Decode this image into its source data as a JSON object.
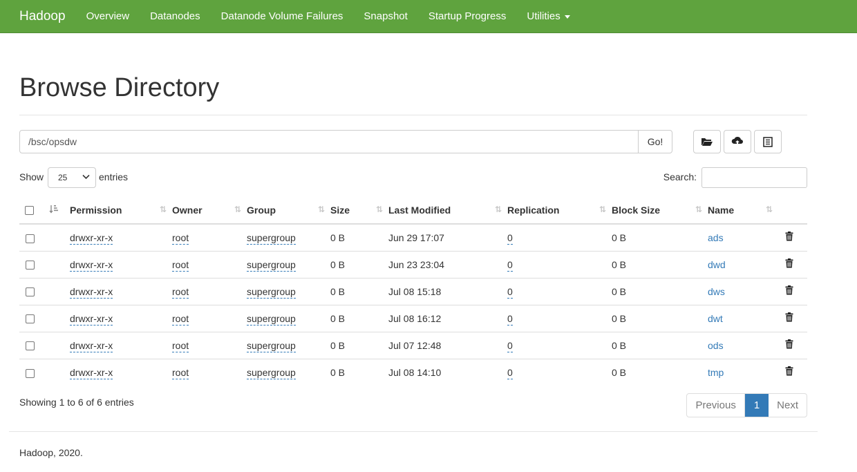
{
  "navbar": {
    "brand": "Hadoop",
    "items": [
      {
        "label": "Overview"
      },
      {
        "label": "Datanodes"
      },
      {
        "label": "Datanode Volume Failures"
      },
      {
        "label": "Snapshot"
      },
      {
        "label": "Startup Progress"
      },
      {
        "label": "Utilities"
      }
    ],
    "color": "#5fa33e"
  },
  "page": {
    "title": "Browse Directory",
    "path_value": "/bsc/opsdw",
    "go_label": "Go!"
  },
  "toolbar": {
    "icons": [
      "folder-open-icon",
      "cloud-upload-icon",
      "list-icon"
    ]
  },
  "controls": {
    "show_label": "Show",
    "page_length": "25",
    "entries_label": "entries",
    "search_label": "Search:"
  },
  "table": {
    "headers": [
      "Permission",
      "Owner",
      "Group",
      "Size",
      "Last Modified",
      "Replication",
      "Block Size",
      "Name"
    ],
    "rows": [
      {
        "permission": "drwxr-xr-x",
        "owner": "root",
        "group": "supergroup",
        "size": "0 B",
        "modified": "Jun 29 17:07",
        "replication": "0",
        "block_size": "0 B",
        "name": "ads"
      },
      {
        "permission": "drwxr-xr-x",
        "owner": "root",
        "group": "supergroup",
        "size": "0 B",
        "modified": "Jun 23 23:04",
        "replication": "0",
        "block_size": "0 B",
        "name": "dwd"
      },
      {
        "permission": "drwxr-xr-x",
        "owner": "root",
        "group": "supergroup",
        "size": "0 B",
        "modified": "Jul 08 15:18",
        "replication": "0",
        "block_size": "0 B",
        "name": "dws"
      },
      {
        "permission": "drwxr-xr-x",
        "owner": "root",
        "group": "supergroup",
        "size": "0 B",
        "modified": "Jul 08 16:12",
        "replication": "0",
        "block_size": "0 B",
        "name": "dwt"
      },
      {
        "permission": "drwxr-xr-x",
        "owner": "root",
        "group": "supergroup",
        "size": "0 B",
        "modified": "Jul 07 12:48",
        "replication": "0",
        "block_size": "0 B",
        "name": "ods"
      },
      {
        "permission": "drwxr-xr-x",
        "owner": "root",
        "group": "supergroup",
        "size": "0 B",
        "modified": "Jul 08 14:10",
        "replication": "0",
        "block_size": "0 B",
        "name": "tmp"
      }
    ]
  },
  "pagination": {
    "info": "Showing 1 to 6 of 6 entries",
    "previous": "Previous",
    "current": "1",
    "next": "Next",
    "active_color": "#337ab7"
  },
  "footer": {
    "text": "Hadoop, 2020."
  }
}
